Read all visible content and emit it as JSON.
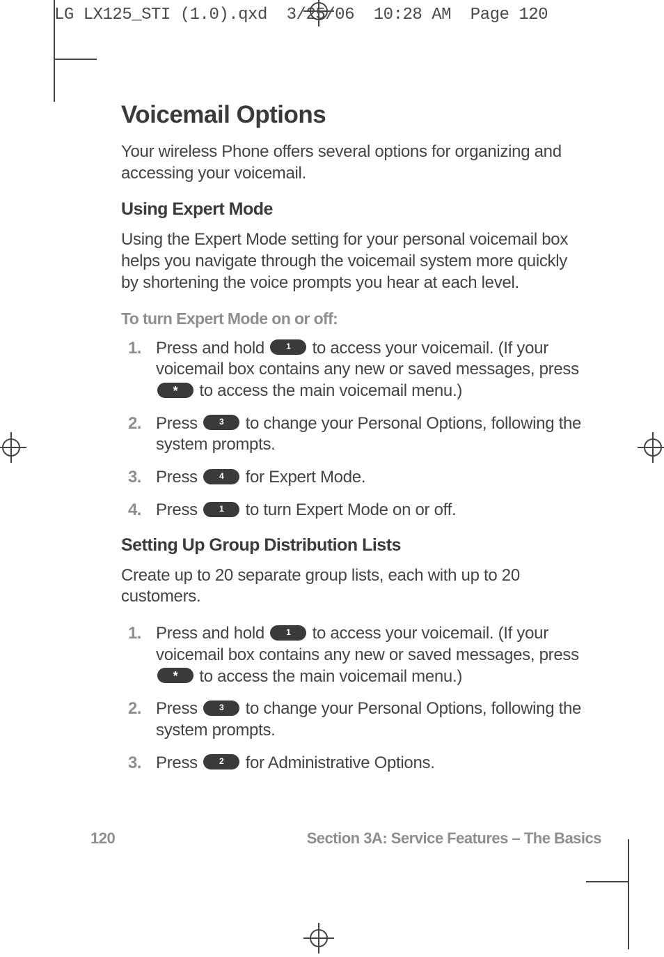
{
  "fileHeader": "LG LX125_STI (1.0).qxd  3/25/06  10:28 AM  Page 120",
  "title": "Voicemail Options",
  "intro": "Your wireless Phone offers several options for organizing and accessing your voicemail.",
  "section1": {
    "heading": "Using Expert Mode",
    "body": "Using the Expert Mode setting for your personal voicemail box helps you navigate through the voicemail system more quickly by shortening the voice prompts you hear at each level.",
    "leadIn": "To turn Expert Mode on or off:",
    "steps": [
      {
        "num": "1.",
        "parts": [
          {
            "t": "text",
            "v": "Press and hold "
          },
          {
            "t": "key",
            "v": "1"
          },
          {
            "t": "text",
            "v": " to access your voicemail. (If your voicemail box contains any new or saved messages, press "
          },
          {
            "t": "key",
            "v": "*"
          },
          {
            "t": "text",
            "v": " to access the main voicemail menu.)"
          }
        ]
      },
      {
        "num": "2.",
        "parts": [
          {
            "t": "text",
            "v": "Press "
          },
          {
            "t": "key",
            "v": "3"
          },
          {
            "t": "text",
            "v": " to change your Personal Options, following the system prompts."
          }
        ]
      },
      {
        "num": "3.",
        "parts": [
          {
            "t": "text",
            "v": "Press "
          },
          {
            "t": "key",
            "v": "4"
          },
          {
            "t": "text",
            "v": " for Expert Mode."
          }
        ]
      },
      {
        "num": "4.",
        "parts": [
          {
            "t": "text",
            "v": "Press "
          },
          {
            "t": "key",
            "v": "1"
          },
          {
            "t": "text",
            "v": " to turn Expert Mode on or off."
          }
        ]
      }
    ]
  },
  "section2": {
    "heading": "Setting Up Group Distribution Lists",
    "body": "Create up to 20 separate group lists, each with up to 20 customers.",
    "steps": [
      {
        "num": "1.",
        "parts": [
          {
            "t": "text",
            "v": "Press and hold "
          },
          {
            "t": "key",
            "v": "1"
          },
          {
            "t": "text",
            "v": " to access your voicemail. (If your voicemail box contains any new or saved messages, press "
          },
          {
            "t": "key",
            "v": "*"
          },
          {
            "t": "text",
            "v": " to access the main voicemail menu.)"
          }
        ]
      },
      {
        "num": "2.",
        "parts": [
          {
            "t": "text",
            "v": "Press "
          },
          {
            "t": "key",
            "v": "3"
          },
          {
            "t": "text",
            "v": " to change your Personal Options, following the system prompts."
          }
        ]
      },
      {
        "num": "3.",
        "parts": [
          {
            "t": "text",
            "v": "Press "
          },
          {
            "t": "key",
            "v": "2"
          },
          {
            "t": "text",
            "v": " for Administrative Options."
          }
        ]
      }
    ]
  },
  "footer": {
    "pageNum": "120",
    "sectionLabel": "Section 3A: Service Features – The Basics"
  }
}
